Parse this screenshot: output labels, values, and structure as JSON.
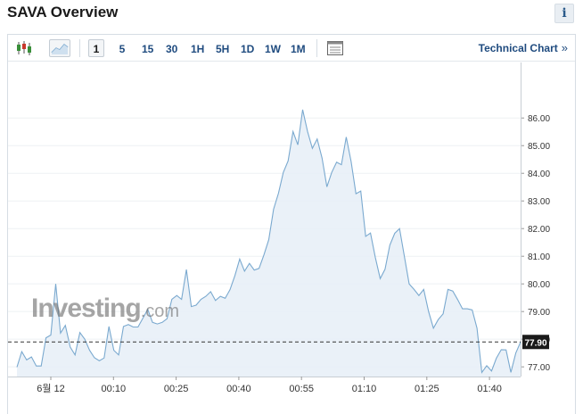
{
  "header": {
    "title": "SAVA Overview",
    "info_label": "i"
  },
  "toolbar": {
    "periods": [
      "1",
      "5",
      "15",
      "30",
      "1H",
      "5H",
      "1D",
      "1W",
      "1M"
    ],
    "active_period": "1",
    "technical_link": "Technical Chart",
    "technical_arrow": "»"
  },
  "watermark": {
    "brand": "Investing",
    "tld": ".com"
  },
  "colors": {
    "line": "#7aa9cf",
    "area": "#e6eef7",
    "accent": "#1f4b7f",
    "price_tag": "#1a1a1a"
  },
  "chart_data": {
    "type": "area",
    "x_ticks": [
      "6월 12",
      "00:10",
      "00:25",
      "00:40",
      "00:55",
      "01:10",
      "01:25",
      "01:40"
    ],
    "y_ticks": [
      "77.00",
      "78.00",
      "79.00",
      "80.00",
      "81.00",
      "82.00",
      "83.00",
      "84.00",
      "85.00",
      "86.00"
    ],
    "ylim": [
      76.65,
      87.75
    ],
    "current_value": 77.9,
    "current_label": "77.90",
    "values": [
      76.99,
      77.55,
      77.25,
      77.36,
      77.03,
      77.03,
      78.05,
      78.15,
      80.0,
      78.22,
      78.5,
      77.71,
      77.43,
      78.24,
      78.0,
      77.6,
      77.33,
      77.22,
      77.32,
      78.46,
      77.6,
      77.43,
      78.46,
      78.53,
      78.44,
      78.44,
      78.76,
      79.08,
      78.61,
      78.55,
      78.61,
      78.74,
      79.44,
      79.58,
      79.44,
      80.52,
      79.18,
      79.23,
      79.44,
      79.55,
      79.72,
      79.4,
      79.55,
      79.48,
      79.79,
      80.3,
      80.9,
      80.46,
      80.74,
      80.5,
      80.56,
      81.05,
      81.6,
      82.7,
      83.28,
      84.03,
      84.45,
      85.51,
      85.03,
      86.3,
      85.51,
      84.9,
      85.24,
      84.55,
      83.51,
      84.03,
      84.4,
      84.31,
      85.31,
      84.42,
      83.26,
      83.36,
      81.72,
      81.84,
      80.96,
      80.19,
      80.53,
      81.4,
      81.83,
      82.0,
      81.0,
      80.0,
      79.8,
      79.58,
      79.8,
      79.0,
      78.4,
      78.71,
      78.92,
      79.8,
      79.74,
      79.43,
      79.1,
      79.1,
      79.06,
      78.4,
      76.8,
      77.04,
      76.85,
      77.31,
      77.62,
      77.61,
      76.8,
      77.5,
      77.9
    ]
  }
}
